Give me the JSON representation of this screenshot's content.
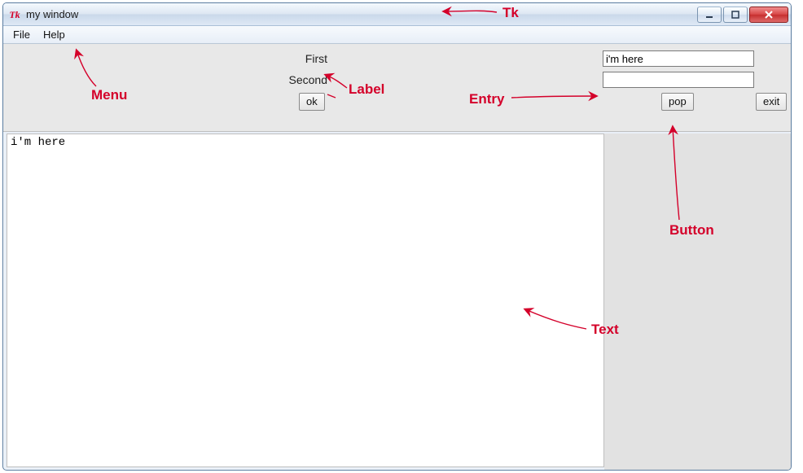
{
  "window": {
    "title": "my window",
    "icon_label": "Tk"
  },
  "menubar": {
    "items": [
      "File",
      "Help"
    ]
  },
  "form": {
    "rows": [
      {
        "label": "First",
        "value": "i'm here"
      },
      {
        "label": "Second",
        "value": ""
      }
    ],
    "buttons": {
      "ok": "ok",
      "pop": "pop",
      "exit": "exit"
    }
  },
  "textwidget": {
    "content": "i'm here"
  },
  "annotations": {
    "tk": "Tk",
    "menu": "Menu",
    "label": "Label",
    "entry": "Entry",
    "button": "Button",
    "text": "Text"
  }
}
